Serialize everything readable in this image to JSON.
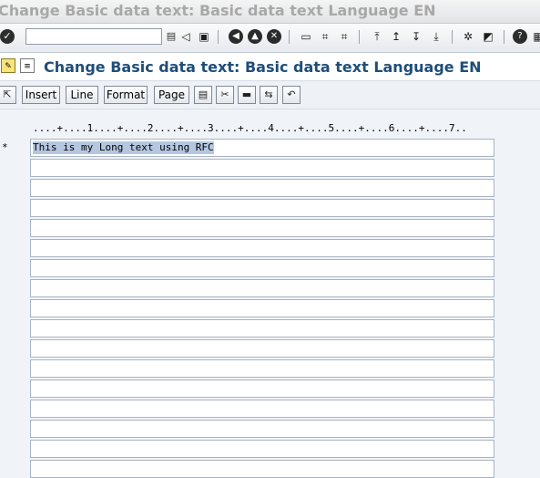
{
  "window": {
    "title": "Change Basic data text: Basic data text Language EN"
  },
  "std_toolbar": {
    "ok_icon": "checkmark-icon",
    "command_field": {
      "value": "",
      "placeholder": ""
    },
    "icons": [
      "back-icon",
      "save-icon",
      "navigate-back-icon",
      "exit-icon",
      "cancel-icon",
      "print-icon",
      "find-icon",
      "find-next-icon",
      "first-page-icon",
      "previous-page-icon",
      "next-page-icon",
      "last-page-icon",
      "create-session-icon",
      "shortcut-icon",
      "help-icon",
      "customize-layout-icon"
    ]
  },
  "header": {
    "title": "Change Basic data text: Basic data text Language EN"
  },
  "app_toolbar": {
    "buttons": [
      "Insert",
      "Line",
      "Format",
      "Page"
    ]
  },
  "editor": {
    "ruler": "....+....1....+....2....+....3....+....4....+....5....+....6....+....7..",
    "line_marker": "*",
    "lines": [
      "This is my Long text using RFC",
      "",
      "",
      "",
      "",
      "",
      "",
      "",
      "",
      "",
      "",
      "",
      "",
      "",
      "",
      "",
      "",
      ""
    ]
  }
}
